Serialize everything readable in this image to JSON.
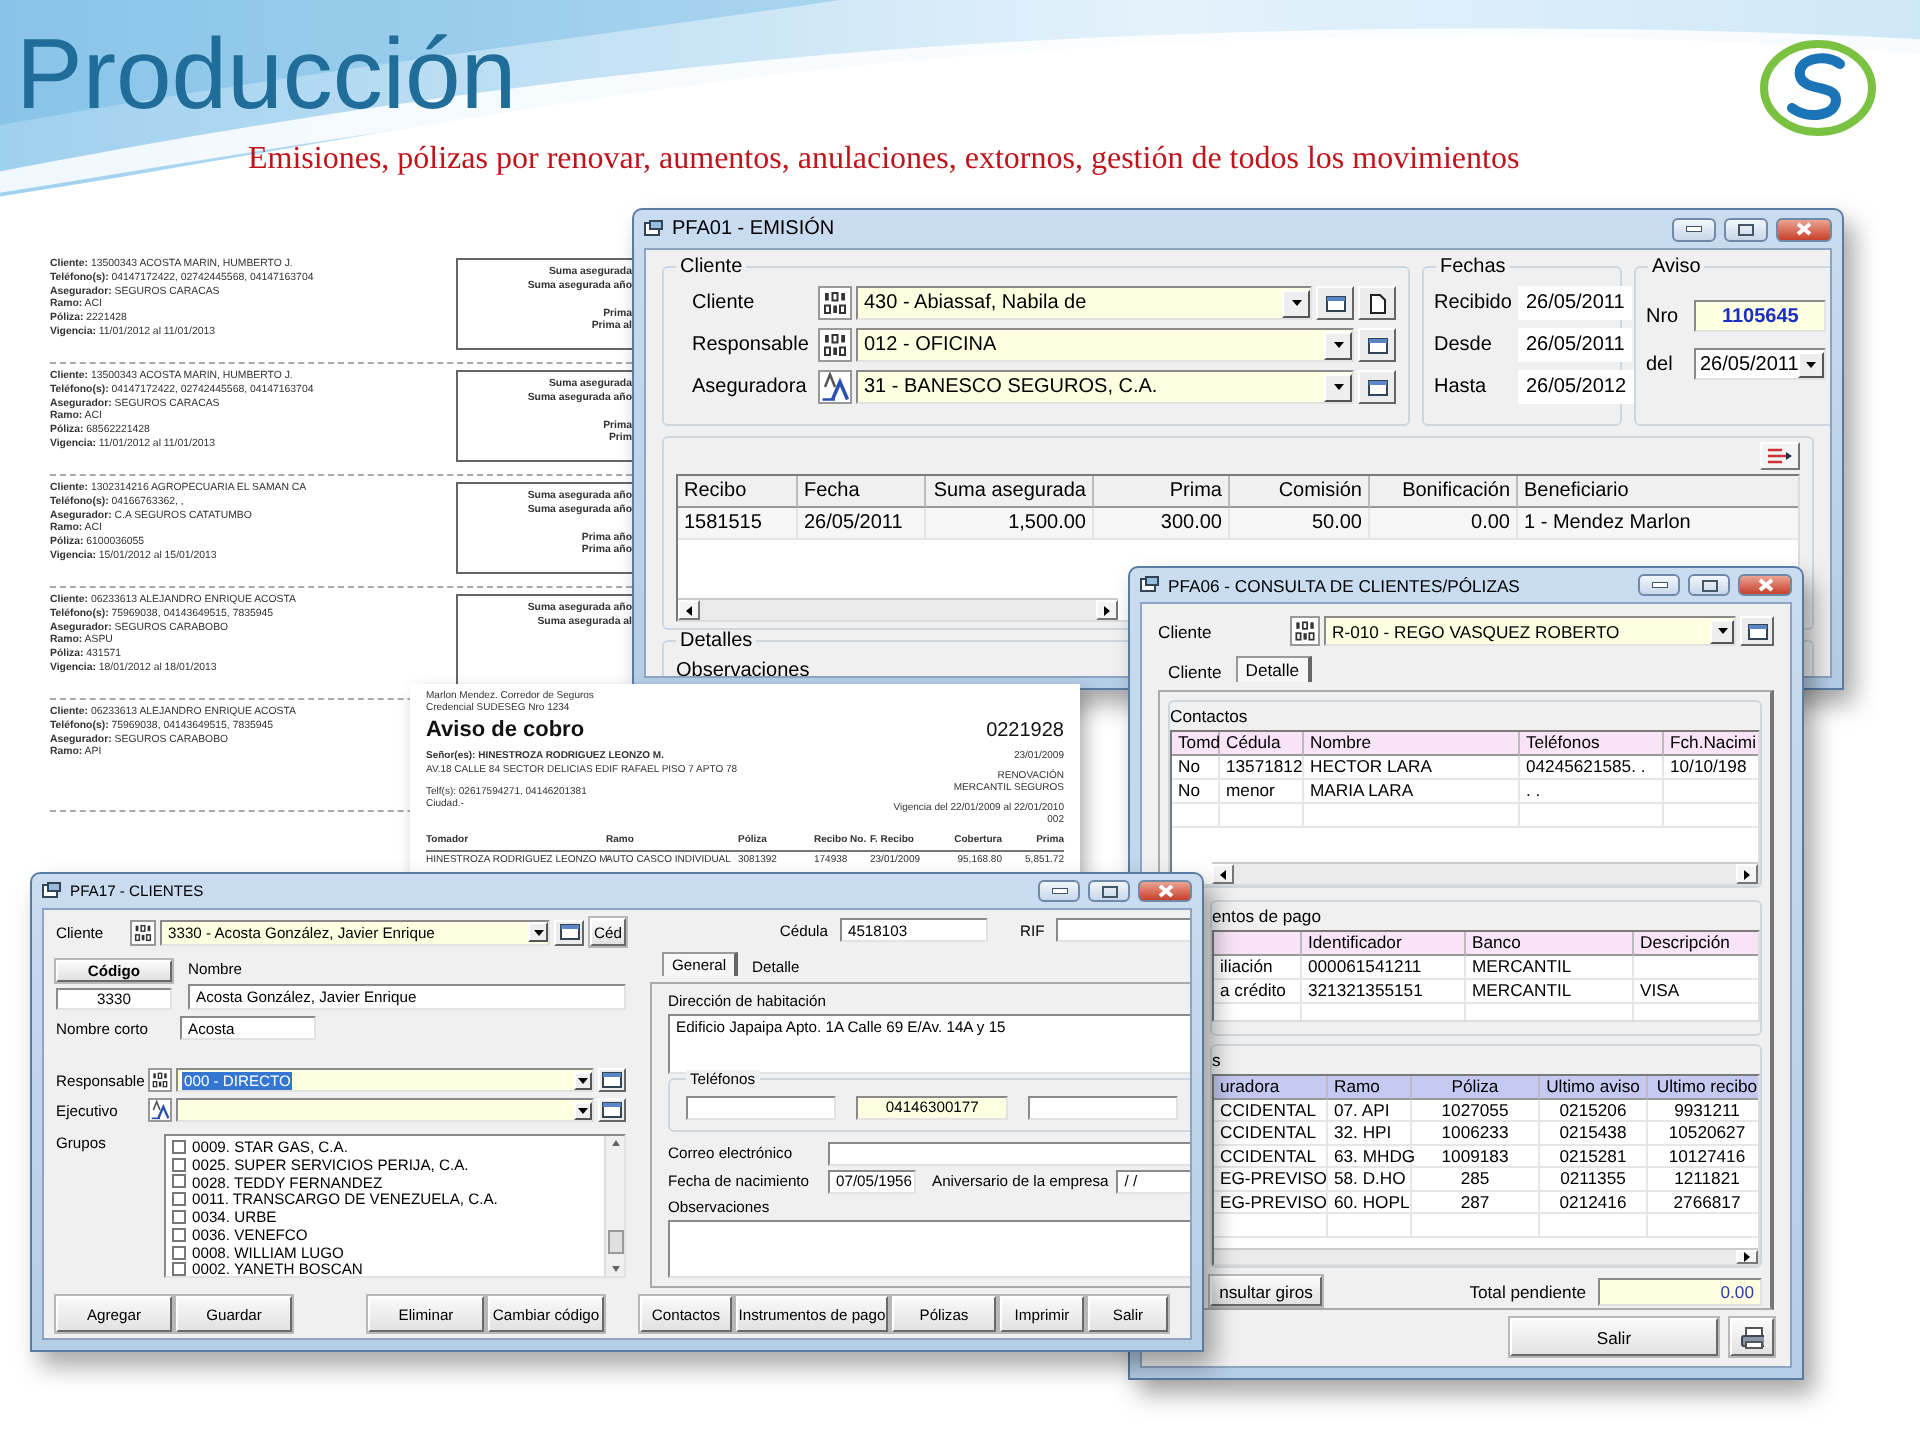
{
  "slide": {
    "title": "Producción",
    "subtitle": "Emisiones, pólizas por renovar, aumentos, anulaciones, extornos, gestión de todos los movimientos"
  },
  "report": {
    "records": [
      {
        "fields": [
          "**Cliente:** 13500343 ACOSTA MARIN, HUMBERTO J.",
          "**Teléfono(s):** 04147172422, 02742445568, 04147163704",
          "**Asegurador:** SEGUROS CARACAS",
          "**Ramo:** ACI",
          "**Póliza:** 2221428",
          "**Vigencia:** 11/01/2012 al 11/01/2013"
        ],
        "box_labels": [
          "Suma asegurada",
          "Suma asegurada año",
          "Prima",
          "Prima al"
        ]
      },
      {
        "fields": [
          "**Cliente:** 13500343 ACOSTA MARIN, HUMBERTO J.",
          "**Teléfono(s):** 04147172422, 02742445568, 04147163704",
          "**Asegurador:** SEGUROS CARACAS",
          "**Ramo:** ACI",
          "**Póliza:** 68562221428",
          "**Vigencia:** 11/01/2012 al 11/01/2013"
        ],
        "box_labels": [
          "Suma asegurada",
          "Suma asegurada año",
          "Prima",
          "Prim"
        ]
      },
      {
        "fields": [
          "**Cliente:** 1302314216 AGROPECUARIA EL SAMAN CA",
          "**Teléfono(s):** 04166763362, ,",
          "**Asegurador:** C.A SEGUROS CATATUMBO",
          "**Ramo:** ACI",
          "**Póliza:** 6100036055",
          "**Vigencia:** 15/01/2012 al 15/01/2013"
        ],
        "box_labels": [
          "Suma asegurada año",
          "Suma asegurada año",
          "Prima año",
          "Prima año"
        ]
      },
      {
        "fields": [
          "**Cliente:** 06233613 ALEJANDRO ENRIQUE ACOSTA",
          "**Teléfono(s):** 75969038, 04143649515, 7835945",
          "**Asegurador:** SEGUROS CARABOBO",
          "**Ramo:** ASPU",
          "**Póliza:** 431571",
          "**Vigencia:** 18/01/2012 al 18/01/2013"
        ],
        "box_labels": [
          "Suma asegurada año",
          "Suma asegurada al"
        ]
      },
      {
        "fields": [
          "**Cliente:** 06233613 ALEJANDRO ENRIQUE ACOSTA",
          "**Teléfono(s):** 75969038, 04143649515, 7835945",
          "**Asegurador:** SEGUROS CARABOBO",
          "**Ramo:** API"
        ]
      }
    ]
  },
  "emision_window": {
    "title": "PFA01 - EMISIÓN",
    "cliente_group": {
      "legend": "Cliente",
      "rows": [
        {
          "label": "Cliente",
          "value": "430 - Abiassaf, Nabila de",
          "kind": "code",
          "new_document": true
        },
        {
          "label": "Responsable",
          "value": "012 - OFICINA",
          "kind": "code",
          "new_document": false
        },
        {
          "label": "Aseguradora",
          "value": "31 - BANESCO SEGUROS, C.A.",
          "kind": "text",
          "new_document": false
        }
      ]
    },
    "fechas_group": {
      "legend": "Fechas",
      "rows": [
        {
          "label": "Recibido",
          "value": "26/05/2011"
        },
        {
          "label": "Desde",
          "value": "26/05/2011"
        },
        {
          "label": "Hasta",
          "value": "26/05/2012"
        }
      ]
    },
    "aviso_group": {
      "legend": "Aviso",
      "number_label": "Nro",
      "number": "1105645",
      "date_label": "del",
      "date": "26/05/2011"
    },
    "receipts": {
      "columns": [
        "Recibo",
        "Fecha",
        "Suma asegurada",
        "Prima",
        "Comisión",
        "Bonificación",
        "Beneficiario"
      ],
      "rows": [
        [
          "1581515",
          "26/05/2011",
          "1,500.00",
          "300.00",
          "50.00",
          "0.00",
          "1 - Mendez Marlon"
        ]
      ]
    },
    "detalles": {
      "legend": "Detalles",
      "notes_label": "Observaciones"
    }
  },
  "aviso_cobro": {
    "broker": "Marlon Mendez. Corredor de Seguros",
    "credential": "Credencial SUDESEG Nro 1234",
    "title": "Aviso de cobro",
    "number": "0221928",
    "recipient": "Señor(es): HINESTROZA RODRIGUEZ LEONZO M.",
    "address": "AV.18 CALLE 84 SECTOR DELICIAS EDIF RAFAEL PISO 7 APTO 78",
    "phones": "Telf(s): 02617594271, 04146201381",
    "city": "Ciudad.-",
    "date": "23/01/2009",
    "type": "RENOVACIÓN",
    "insurer": "MERCANTIL SEGUROS",
    "validity": "Vigencia del 22/01/2009 al 22/01/2010",
    "code": "002",
    "columns": [
      "Tomador",
      "Ramo",
      "Póliza",
      "Recibo No.",
      "F. Recibo",
      "Cobertura",
      "Prima"
    ],
    "rows": [
      [
        "HINESTROZA RODRIGUEZ LEONZO M",
        "AUTO CASCO INDIVIDUAL",
        "3081392",
        "174938",
        "23/01/2009",
        "95,168.80",
        "5,851.72"
      ]
    ]
  },
  "consulta_window": {
    "title": "PFA06 - CONSULTA DE CLIENTES/PÓLIZAS",
    "client": {
      "label": "Cliente",
      "value": "R-010 - REGO VASQUEZ ROBERTO",
      "kind": "code"
    },
    "tabs": [
      {
        "label": "Cliente",
        "selected": false
      },
      {
        "label": "Detalle",
        "selected": true
      }
    ],
    "contactos": {
      "legend": "Contactos",
      "columns": [
        "Tomd",
        "Cédula",
        "Nombre",
        "Teléfonos",
        "Fch.Nacimi"
      ],
      "rows": [
        [
          "No",
          "13571812",
          "HECTOR LARA",
          "04245621585. .",
          "10/10/198"
        ],
        [
          "No",
          "menor",
          "MARIA LARA",
          ". ."
        ]
      ]
    },
    "instrumentos": {
      "legend": "entos de pago",
      "columns": [
        "",
        "Identificador",
        "Banco",
        "Descripción"
      ],
      "rows": [
        [
          "iliación",
          "000061541211",
          "MERCANTIL"
        ],
        [
          "a crédito",
          "321321355151",
          "MERCANTIL",
          "VISA"
        ]
      ]
    },
    "polizas": {
      "legend": "s",
      "columns": [
        "uradora",
        "Ramo",
        "Póliza",
        "Ultimo aviso",
        "Ultimo recibo"
      ],
      "rows": [
        [
          "CCIDENTAL",
          "07. API",
          "1027055",
          "0215206",
          "9931211"
        ],
        [
          "CCIDENTAL",
          "32. HPI",
          "1006233",
          "0215438",
          "10520627"
        ],
        [
          "CCIDENTAL",
          "63. MHDG",
          "1009183",
          "0215281",
          "10127416"
        ],
        [
          "EG-PREVISO",
          "58. D.HO",
          "285",
          "0211355",
          "1211821"
        ],
        [
          "EG-PREVISO",
          "60. HOPL",
          "287",
          "0212416",
          "2766817"
        ]
      ]
    },
    "giros_button": "nsultar giros",
    "total_label": "Total pendiente",
    "total": "0.00",
    "exit_button": "Salir"
  },
  "clientes_window": {
    "title": "PFA17 - CLIENTES",
    "client": {
      "label": "Cliente",
      "value": "3330 - Acosta González, Javier Enrique",
      "kind": "code"
    },
    "id_button": "Céd",
    "code_button": "Código",
    "code": "3330",
    "name_label": "Nombre",
    "name": "Acosta González, Javier Enrique",
    "short_name_label": "Nombre corto",
    "short_name": "Acosta",
    "responsable": {
      "label": "Responsable",
      "value": "000 - DIRECTO",
      "kind": "code",
      "text_selected": true
    },
    "ejecutivo": {
      "label": "Ejecutivo",
      "kind": "text"
    },
    "groups_label": "Grupos",
    "groups": [
      {
        "label": "0009. STAR GAS, C.A.",
        "checked": false
      },
      {
        "label": "0025. SUPER SERVICIOS PERIJA, C.A.",
        "checked": false
      },
      {
        "label": "0028. TEDDY FERNANDEZ",
        "checked": false
      },
      {
        "label": "0011. TRANSCARGO DE VENEZUELA, C.A.",
        "checked": false
      },
      {
        "label": "0034. URBE",
        "checked": false
      },
      {
        "label": "0036. VENEFCO",
        "checked": false
      },
      {
        "label": "0008. WILLIAM LUGO",
        "checked": false
      },
      {
        "label": "0002. YANETH BOSCAN",
        "checked": false
      }
    ],
    "cedula_label": "Cédula",
    "cedula": "4518103",
    "rif_label": "RIF",
    "tabs": [
      {
        "label": "General",
        "selected": true
      },
      {
        "label": "Detalle",
        "selected": false
      }
    ],
    "address_label": "Dirección de habitación",
    "address": "Edificio Japaipa Apto. 1A Calle 69 E/Av. 14A y 15",
    "phones_legend": "Teléfonos",
    "phones": [
      {
        "focused": false
      },
      {
        "value": "04146300177",
        "focused": true
      },
      {
        "focused": false
      }
    ],
    "email_label": "Correo electrónico",
    "birth_label": "Fecha de nacimiento",
    "birth": "07/05/1956",
    "anniversary_label": "Aniversario de la empresa",
    "anniversary": "/ /",
    "notes_label": "Observaciones",
    "buttons_left": [
      "Agregar",
      "Guardar",
      "Eliminar",
      "Cambiar código"
    ],
    "buttons_right": [
      "Contactos",
      "Instrumentos de pago",
      "Pólizas",
      "Imprimir",
      "Salir"
    ]
  }
}
